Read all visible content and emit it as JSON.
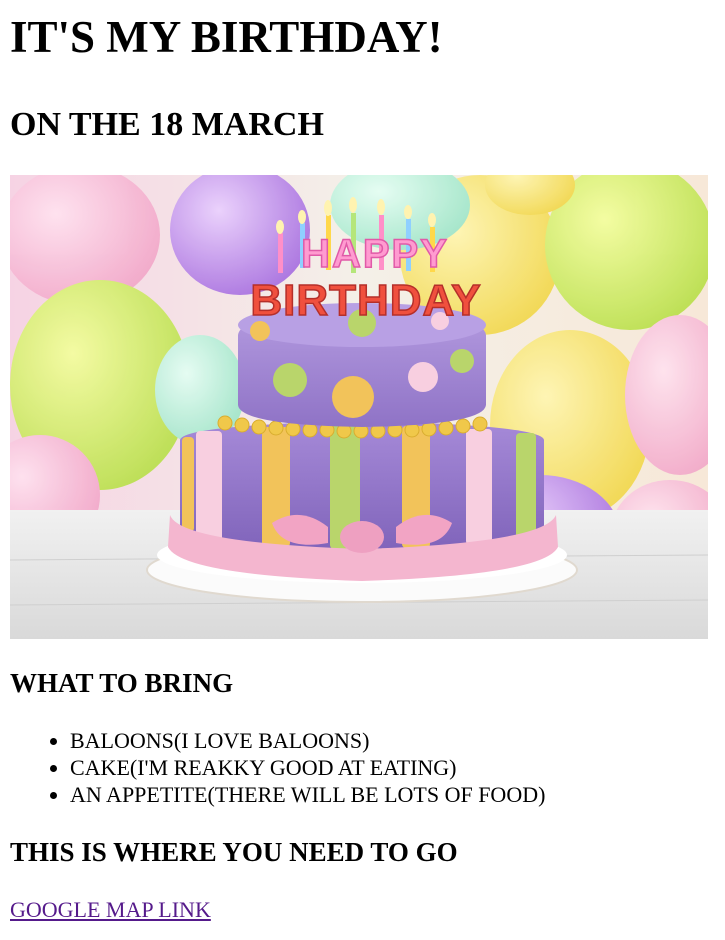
{
  "page": {
    "title": "IT'S MY BIRTHDAY!",
    "subtitle": "ON THE 18 MARCH"
  },
  "image": {
    "cake_topper_line1": "HAPPY",
    "cake_topper_line2": "BIRTHDAY"
  },
  "bring": {
    "heading": "WHAT TO BRING",
    "items": [
      "BALOONS(I LOVE BALOONS)",
      "CAKE(I'M REAKKY GOOD AT EATING)",
      "AN APPETITE(THERE WILL BE LOTS OF FOOD)"
    ]
  },
  "directions": {
    "heading": "THIS IS WHERE YOU NEED TO GO",
    "link_label": "GOOGLE MAP LINK"
  },
  "colors": {
    "link_visited": "#551a8b",
    "cake_purple": "#a98fd8",
    "ribbon_pink": "#f4b6cf"
  }
}
